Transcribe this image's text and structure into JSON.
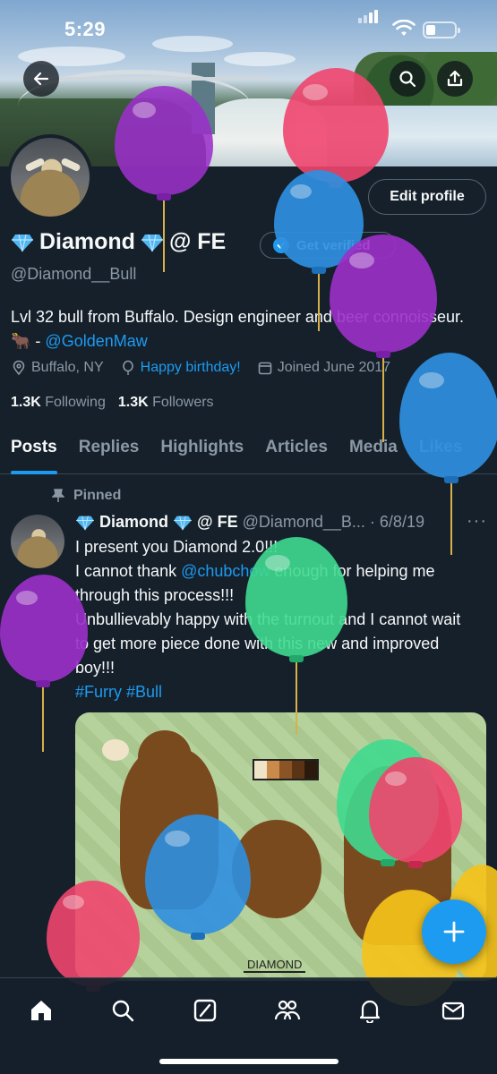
{
  "status_bar": {
    "time": "5:29"
  },
  "header": {
    "back_icon": "back-arrow-icon",
    "search_icon": "search-icon",
    "share_icon": "share-icon"
  },
  "profile": {
    "name": "Diamond",
    "name_suffix": "@ FE",
    "handle": "@Diamond__Bull",
    "edit_label": "Edit profile",
    "verify_label": "Get verified",
    "bio_text": "Lvl 32 bull from Buffalo. Design engineer and beer connoisseur. 🐂 - ",
    "bio_link": "@GoldenMaw",
    "location": "Buffalo, NY",
    "birthday": "Happy birthday!",
    "joined": "Joined June 2017",
    "following_count": "1.3K",
    "following_label": "Following",
    "followers_count": "1.3K",
    "followers_label": "Followers"
  },
  "tabs": [
    {
      "label": "Posts",
      "active": true
    },
    {
      "label": "Replies"
    },
    {
      "label": "Highlights"
    },
    {
      "label": "Articles"
    },
    {
      "label": "Media"
    },
    {
      "label": "Likes"
    }
  ],
  "pinned_post": {
    "pinned_label": "Pinned",
    "author_name": "Diamond",
    "author_suffix": "@ FE",
    "author_handle": "@Diamond__B...",
    "date": "· 6/8/19",
    "text_1": "I present you Diamond 2.0!!!\nI cannot thank ",
    "mention": "@chubchow",
    "text_2": " enough for helping me through this process!!!\nUnbullievably happy with the turnout and I cannot wait to get more piece done with this new and improved boy!!!",
    "hashtags": "#Furry #Bull",
    "image_label": "DIAMOND"
  },
  "colors": {
    "background": "#15202b",
    "accent": "#1d9bf0",
    "muted_text": "#8b98a5",
    "balloon_purple": "#9b30c9",
    "balloon_pink": "#f0456e",
    "balloon_blue": "#2f8fe0",
    "balloon_green": "#3fd98f",
    "balloon_yellow": "#f5c21b"
  },
  "bottom_nav": [
    "home-icon",
    "search-icon",
    "grok-icon",
    "communities-icon",
    "notifications-icon",
    "messages-icon"
  ],
  "fab_icon": "plus-icon"
}
